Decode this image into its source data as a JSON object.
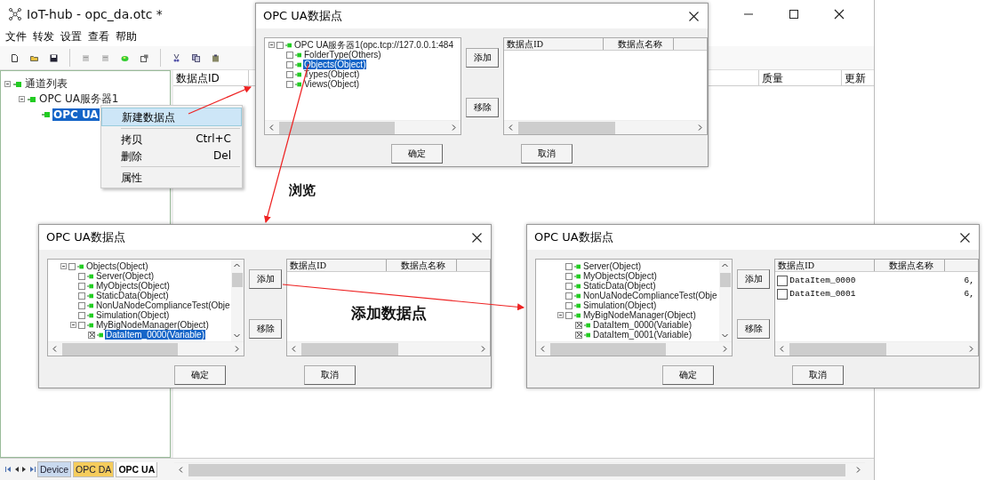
{
  "main_window": {
    "title": "IoT-hub - opc_da.otc *",
    "menu": [
      "文件",
      "转发",
      "设置",
      "查看",
      "帮助"
    ],
    "tree": [
      {
        "label": "通道列表",
        "selected": false,
        "children": [
          {
            "label": "OPC UA服务器1",
            "selected": false,
            "children": [
              {
                "label": "OPC UA",
                "selected": true
              }
            ]
          }
        ]
      }
    ],
    "table": {
      "columns": [
        "数据点ID",
        "质量",
        "更新"
      ]
    },
    "sheet_tabs": [
      {
        "label": "Device",
        "selected": false,
        "color": "#c9d9ee"
      },
      {
        "label": "OPC DA",
        "selected": false,
        "color": "#f5cc5c"
      },
      {
        "label": "OPC UA",
        "selected": true,
        "color": "#ffffff"
      }
    ]
  },
  "context_menu": {
    "groups": [
      [
        {
          "label": "新建数据点",
          "selected": true
        }
      ],
      [
        {
          "label": "拷贝",
          "shortcut": "Ctrl+C",
          "selected": false
        },
        {
          "label": "删除",
          "shortcut": "Del",
          "selected": false
        }
      ],
      [
        {
          "label": "属性",
          "selected": false
        }
      ]
    ]
  },
  "dialogs": [
    {
      "title": "OPC UA数据点",
      "tree": [
        {
          "label": "OPC UA服务器1(opc.tcp://127.0.0.1:484",
          "checked": false,
          "selected": false,
          "children": [
            {
              "label": "FolderType(Others)",
              "checked": false,
              "selected": false
            },
            {
              "label": "Objects(Object)",
              "checked": false,
              "selected": true
            },
            {
              "label": "Types(Object)",
              "checked": false,
              "selected": false
            },
            {
              "label": "Views(Object)",
              "checked": false,
              "selected": false
            }
          ]
        }
      ],
      "add": "添加",
      "remove": "移除",
      "list": {
        "columns": [
          "数据点ID",
          "数据点名称"
        ]
      },
      "ok": "确定",
      "cancel": "取消"
    },
    {
      "title": "OPC UA数据点",
      "tree": [
        {
          "label": "Objects(Object)",
          "checked": false,
          "selected": false,
          "children": [
            {
              "label": "Server(Object)",
              "checked": false,
              "selected": false
            },
            {
              "label": "MyObjects(Object)",
              "checked": false,
              "selected": false
            },
            {
              "label": "StaticData(Object)",
              "checked": false,
              "selected": false
            },
            {
              "label": "NonUaNodeComplianceTest(Obje",
              "checked": false,
              "selected": false
            },
            {
              "label": "Simulation(Object)",
              "checked": false,
              "selected": false
            },
            {
              "label": "MyBigNodeManager(Object)",
              "checked": false,
              "selected": false,
              "children": [
                {
                  "label": "DataItem_0000(Variable)",
                  "checked": true,
                  "selected": true
                }
              ]
            }
          ]
        }
      ],
      "add": "添加",
      "remove": "移除",
      "list": {
        "columns": [
          "数据点ID",
          "数据点名称"
        ]
      },
      "ok": "确定",
      "cancel": "取消"
    },
    {
      "title": "OPC UA数据点",
      "tree": [
        {
          "label": "Server(Object)",
          "checked": false,
          "selected": false
        },
        {
          "label": "MyObjects(Object)",
          "checked": false,
          "selected": false
        },
        {
          "label": "StaticData(Object)",
          "checked": false,
          "selected": false
        },
        {
          "label": "NonUaNodeComplianceTest(Obje",
          "checked": false,
          "selected": false
        },
        {
          "label": "Simulation(Object)",
          "checked": false,
          "selected": false
        },
        {
          "label": "MyBigNodeManager(Object)",
          "checked": false,
          "selected": false,
          "children": [
            {
              "label": "DataItem_0000(Variable)",
              "checked": true,
              "selected": false
            },
            {
              "label": "DataItem_0001(Variable)",
              "checked": true,
              "selected": false
            }
          ]
        }
      ],
      "add": "添加",
      "remove": "移除",
      "list": {
        "columns": [
          "数据点ID",
          "数据点名称"
        ],
        "rows": [
          {
            "checked": false,
            "id": "DataItem_0000",
            "column_3": "6,"
          },
          {
            "checked": false,
            "id": "DataItem_0001",
            "column_3": "6,"
          }
        ]
      },
      "ok": "确定",
      "cancel": "取消"
    }
  ],
  "annotations": [
    "浏览",
    "添加数据点"
  ]
}
